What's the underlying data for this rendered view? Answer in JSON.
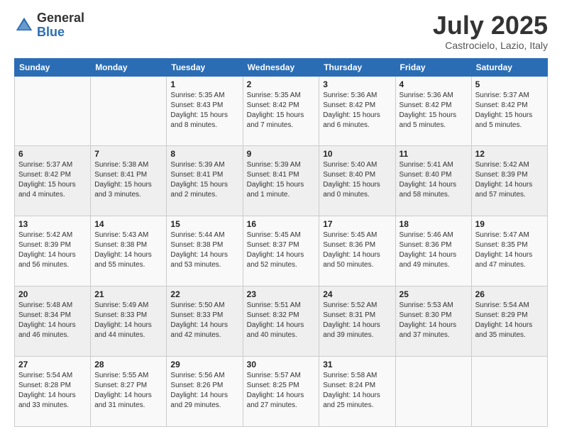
{
  "logo": {
    "general": "General",
    "blue": "Blue"
  },
  "title": "July 2025",
  "location": "Castrocielo, Lazio, Italy",
  "weekdays": [
    "Sunday",
    "Monday",
    "Tuesday",
    "Wednesday",
    "Thursday",
    "Friday",
    "Saturday"
  ],
  "weeks": [
    [
      {
        "day": "",
        "info": ""
      },
      {
        "day": "",
        "info": ""
      },
      {
        "day": "1",
        "info": "Sunrise: 5:35 AM\nSunset: 8:43 PM\nDaylight: 15 hours and 8 minutes."
      },
      {
        "day": "2",
        "info": "Sunrise: 5:35 AM\nSunset: 8:42 PM\nDaylight: 15 hours and 7 minutes."
      },
      {
        "day": "3",
        "info": "Sunrise: 5:36 AM\nSunset: 8:42 PM\nDaylight: 15 hours and 6 minutes."
      },
      {
        "day": "4",
        "info": "Sunrise: 5:36 AM\nSunset: 8:42 PM\nDaylight: 15 hours and 5 minutes."
      },
      {
        "day": "5",
        "info": "Sunrise: 5:37 AM\nSunset: 8:42 PM\nDaylight: 15 hours and 5 minutes."
      }
    ],
    [
      {
        "day": "6",
        "info": "Sunrise: 5:37 AM\nSunset: 8:42 PM\nDaylight: 15 hours and 4 minutes."
      },
      {
        "day": "7",
        "info": "Sunrise: 5:38 AM\nSunset: 8:41 PM\nDaylight: 15 hours and 3 minutes."
      },
      {
        "day": "8",
        "info": "Sunrise: 5:39 AM\nSunset: 8:41 PM\nDaylight: 15 hours and 2 minutes."
      },
      {
        "day": "9",
        "info": "Sunrise: 5:39 AM\nSunset: 8:41 PM\nDaylight: 15 hours and 1 minute."
      },
      {
        "day": "10",
        "info": "Sunrise: 5:40 AM\nSunset: 8:40 PM\nDaylight: 15 hours and 0 minutes."
      },
      {
        "day": "11",
        "info": "Sunrise: 5:41 AM\nSunset: 8:40 PM\nDaylight: 14 hours and 58 minutes."
      },
      {
        "day": "12",
        "info": "Sunrise: 5:42 AM\nSunset: 8:39 PM\nDaylight: 14 hours and 57 minutes."
      }
    ],
    [
      {
        "day": "13",
        "info": "Sunrise: 5:42 AM\nSunset: 8:39 PM\nDaylight: 14 hours and 56 minutes."
      },
      {
        "day": "14",
        "info": "Sunrise: 5:43 AM\nSunset: 8:38 PM\nDaylight: 14 hours and 55 minutes."
      },
      {
        "day": "15",
        "info": "Sunrise: 5:44 AM\nSunset: 8:38 PM\nDaylight: 14 hours and 53 minutes."
      },
      {
        "day": "16",
        "info": "Sunrise: 5:45 AM\nSunset: 8:37 PM\nDaylight: 14 hours and 52 minutes."
      },
      {
        "day": "17",
        "info": "Sunrise: 5:45 AM\nSunset: 8:36 PM\nDaylight: 14 hours and 50 minutes."
      },
      {
        "day": "18",
        "info": "Sunrise: 5:46 AM\nSunset: 8:36 PM\nDaylight: 14 hours and 49 minutes."
      },
      {
        "day": "19",
        "info": "Sunrise: 5:47 AM\nSunset: 8:35 PM\nDaylight: 14 hours and 47 minutes."
      }
    ],
    [
      {
        "day": "20",
        "info": "Sunrise: 5:48 AM\nSunset: 8:34 PM\nDaylight: 14 hours and 46 minutes."
      },
      {
        "day": "21",
        "info": "Sunrise: 5:49 AM\nSunset: 8:33 PM\nDaylight: 14 hours and 44 minutes."
      },
      {
        "day": "22",
        "info": "Sunrise: 5:50 AM\nSunset: 8:33 PM\nDaylight: 14 hours and 42 minutes."
      },
      {
        "day": "23",
        "info": "Sunrise: 5:51 AM\nSunset: 8:32 PM\nDaylight: 14 hours and 40 minutes."
      },
      {
        "day": "24",
        "info": "Sunrise: 5:52 AM\nSunset: 8:31 PM\nDaylight: 14 hours and 39 minutes."
      },
      {
        "day": "25",
        "info": "Sunrise: 5:53 AM\nSunset: 8:30 PM\nDaylight: 14 hours and 37 minutes."
      },
      {
        "day": "26",
        "info": "Sunrise: 5:54 AM\nSunset: 8:29 PM\nDaylight: 14 hours and 35 minutes."
      }
    ],
    [
      {
        "day": "27",
        "info": "Sunrise: 5:54 AM\nSunset: 8:28 PM\nDaylight: 14 hours and 33 minutes."
      },
      {
        "day": "28",
        "info": "Sunrise: 5:55 AM\nSunset: 8:27 PM\nDaylight: 14 hours and 31 minutes."
      },
      {
        "day": "29",
        "info": "Sunrise: 5:56 AM\nSunset: 8:26 PM\nDaylight: 14 hours and 29 minutes."
      },
      {
        "day": "30",
        "info": "Sunrise: 5:57 AM\nSunset: 8:25 PM\nDaylight: 14 hours and 27 minutes."
      },
      {
        "day": "31",
        "info": "Sunrise: 5:58 AM\nSunset: 8:24 PM\nDaylight: 14 hours and 25 minutes."
      },
      {
        "day": "",
        "info": ""
      },
      {
        "day": "",
        "info": ""
      }
    ]
  ]
}
